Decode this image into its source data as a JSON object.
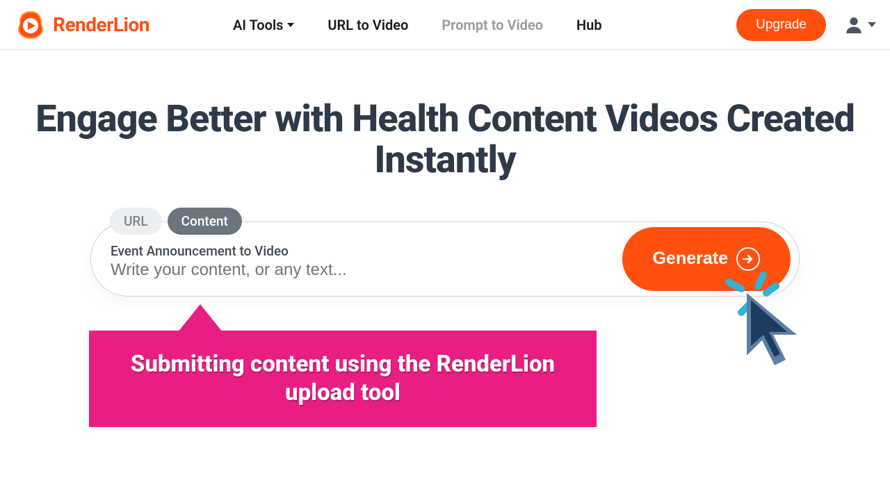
{
  "brand": {
    "name": "RenderLion"
  },
  "nav": {
    "ai_tools": "AI Tools",
    "url_to_video": "URL to Video",
    "prompt_to_video": "Prompt to Video",
    "hub": "Hub"
  },
  "actions": {
    "upgrade": "Upgrade"
  },
  "hero": {
    "title": "Engage Better with Health Content Videos Created Instantly"
  },
  "tabs": {
    "url": "URL",
    "content": "Content"
  },
  "input": {
    "label": "Event Announcement to Video",
    "placeholder": "Write your content, or any text...",
    "generate": "Generate"
  },
  "callout": {
    "text": "Submitting content using the RenderLion upload tool"
  },
  "colors": {
    "accent": "#ff5010",
    "callout": "#e91e82",
    "burst": "#2fb4d6",
    "cursor": "#1d3a5f"
  }
}
